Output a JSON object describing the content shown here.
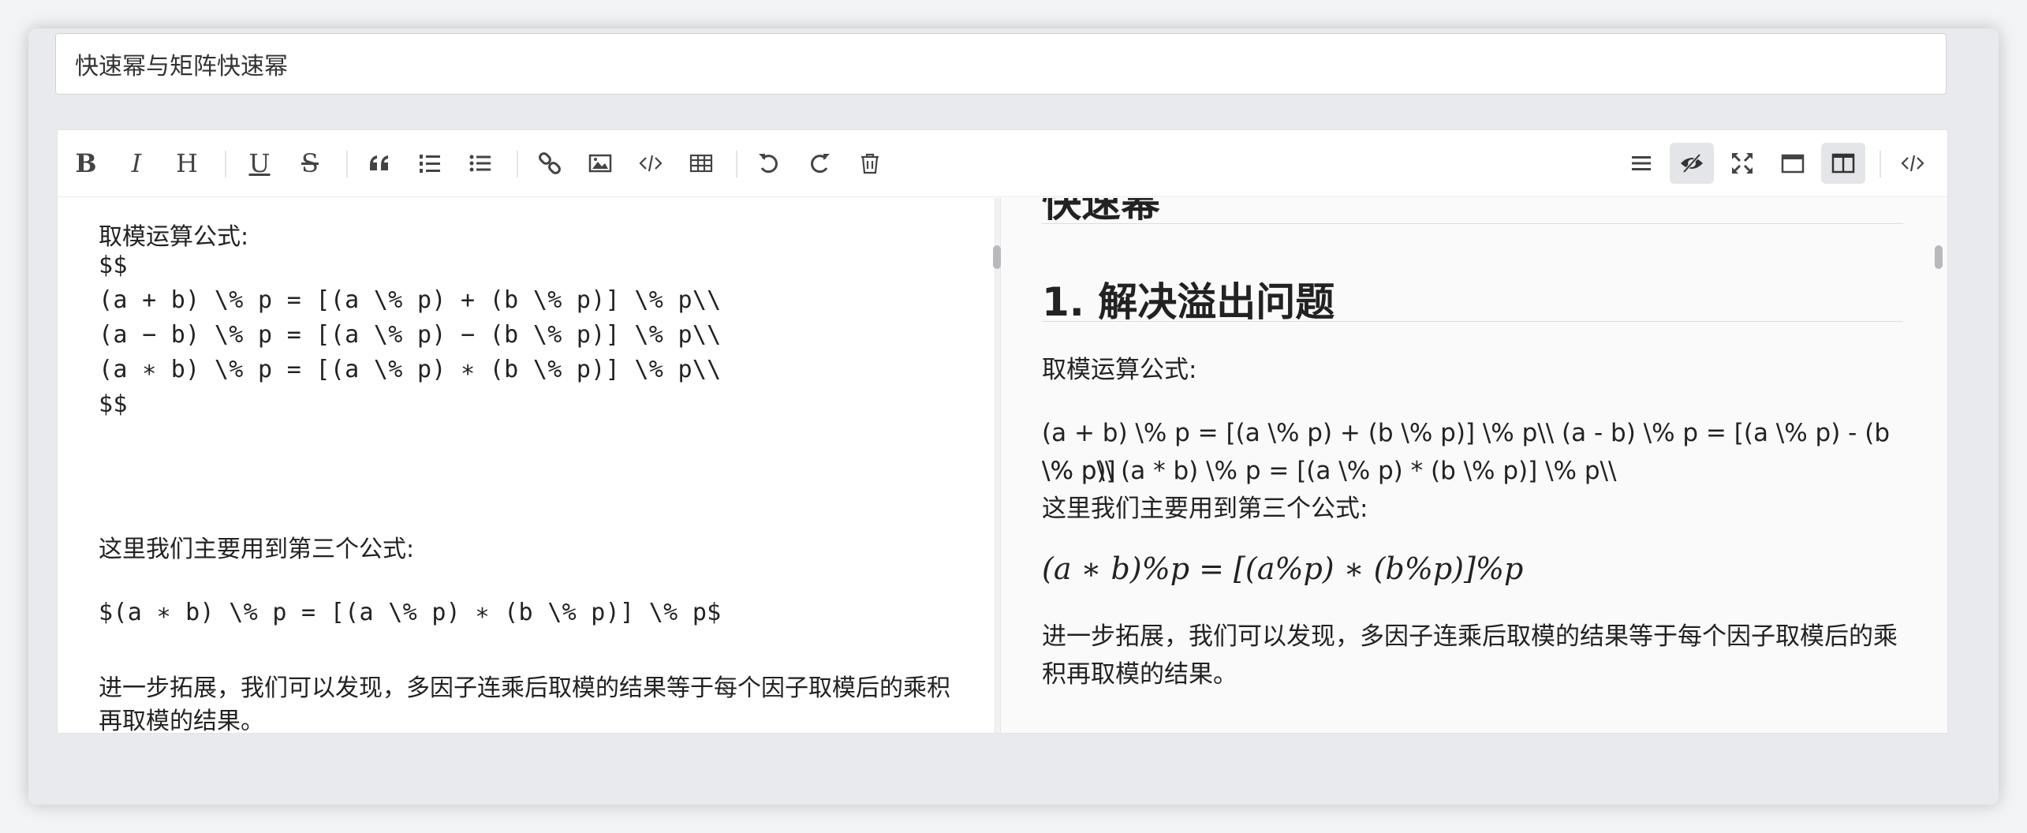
{
  "title_input": {
    "value": "快速幂与矩阵快速幂"
  },
  "toolbar": {
    "bold": "B",
    "italic": "I",
    "heading": "H",
    "underline": "U",
    "strike": "S"
  },
  "source_lines": [
    "取模运算公式:",
    "$$",
    "(a + b) \\% p = [(a \\% p) + (b \\% p)] \\% p\\\\",
    "(a − b) \\% p = [(a \\% p) − (b \\% p)] \\% p\\\\",
    "(a ∗ b) \\% p = [(a \\% p) ∗ (b \\% p)] \\% p\\\\",
    "$$",
    "这里我们主要用到第三个公式:",
    "$(a ∗ b) \\% p = [(a \\% p) ∗ (b \\% p)] \\% p$",
    "进一步拓展，我们可以发现，多因子连乘后取模的结果等于每个因子取模后的乘积",
    "再取模的结果。"
  ],
  "preview": {
    "h1_partial": "快速幂",
    "h2": "1. 解决溢出问题",
    "p1": "取模运算公式:",
    "p2_line1": "(a + b) \\% p = [(a \\% p) + (b \\% p)] \\% p\\\\ (a - b) \\% p = [(a \\% p) - (b \\% p)]",
    "p2_line2": "\\% p\\\\ (a * b) \\% p = [(a \\% p) * (b \\% p)] \\% p\\\\",
    "p3": "这里我们主要用到第三个公式:",
    "math": "(a ∗ b)%p = [(a%p) ∗ (b%p)]%p",
    "p4": "进一步拓展，我们可以发现，多因子连乘后取模的结果等于每个因子取模后的乘积再取模的结果。"
  }
}
